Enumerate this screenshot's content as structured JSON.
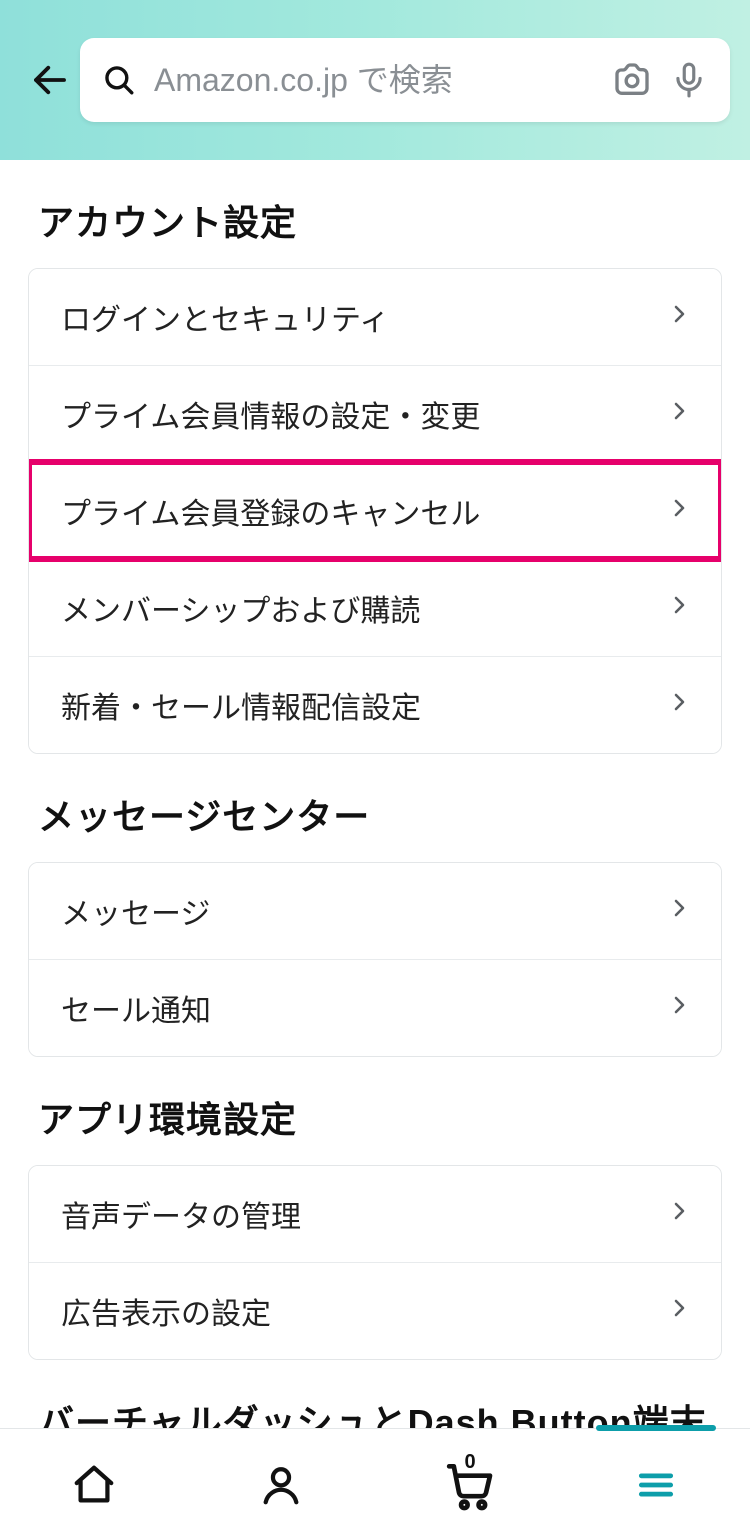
{
  "search": {
    "placeholder": "Amazon.co.jp で検索"
  },
  "sections": [
    {
      "title": "アカウント設定",
      "items": [
        {
          "label": "ログインとセキュリティ"
        },
        {
          "label": "プライム会員情報の設定・変更"
        },
        {
          "label": "プライム会員登録のキャンセル",
          "highlight": true
        },
        {
          "label": "メンバーシップおよび購読"
        },
        {
          "label": "新着・セール情報配信設定"
        }
      ]
    },
    {
      "title": "メッセージセンター",
      "items": [
        {
          "label": "メッセージ"
        },
        {
          "label": "セール通知"
        }
      ]
    },
    {
      "title": "アプリ環境設定",
      "items": [
        {
          "label": "音声データの管理"
        },
        {
          "label": "広告表示の設定"
        }
      ]
    },
    {
      "title": "バーチャルダッシュとDash Button端末",
      "items": []
    }
  ],
  "cart_badge": "0"
}
